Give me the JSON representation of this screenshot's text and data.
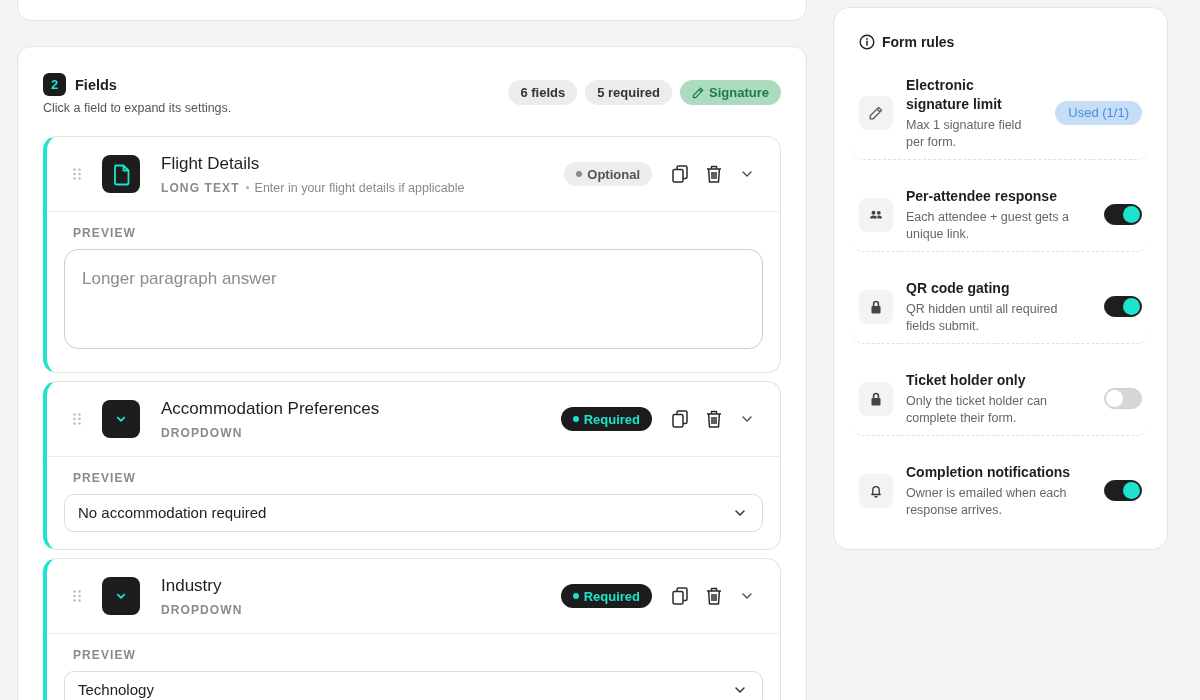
{
  "step": {
    "number": "2",
    "title": "Fields",
    "subtitle": "Click a field to expand its settings."
  },
  "chips": [
    {
      "label": "6 fields",
      "kind": "count"
    },
    {
      "label": "5 required",
      "kind": "count"
    },
    {
      "label": "Signature",
      "kind": "signature"
    }
  ],
  "fields": [
    {
      "kind": "long_text",
      "title": "Flight Details",
      "type_label": "LONG TEXT",
      "description": "Enter in your flight details if applicable",
      "required": false,
      "badge": "Optional",
      "expanded": true,
      "preview_label": "PREVIEW",
      "placeholder": "Longer paragraph answer"
    },
    {
      "kind": "dropdown",
      "title": "Accommodation Preferences",
      "type_label": "DROPDOWN",
      "required": true,
      "badge": "Required",
      "expanded": true,
      "preview_label": "PREVIEW",
      "value": "No accommodation required"
    },
    {
      "kind": "dropdown",
      "title": "Industry",
      "type_label": "DROPDOWN",
      "required": true,
      "badge": "Required",
      "expanded": true,
      "preview_label": "PREVIEW",
      "value": "Technology"
    }
  ],
  "form_rules": {
    "title": "Form rules",
    "rules": [
      {
        "kind": "badge",
        "title": "Electronic signature limit",
        "description": "Max 1 signature field per form.",
        "badge": "Used (1/1)"
      },
      {
        "kind": "toggle",
        "title": "Per-attendee response",
        "description": "Each attendee + guest gets a unique link.",
        "on": true
      },
      {
        "kind": "toggle",
        "title": "QR code gating",
        "description": "QR hidden until all required fields submit.",
        "on": true
      },
      {
        "kind": "toggle",
        "title": "Ticket holder only",
        "description": "Only the ticket holder can complete their form.",
        "on": false
      },
      {
        "kind": "toggle",
        "title": "Completion notifications",
        "description": "Owner is emailed when each response arrives.",
        "on": true
      }
    ]
  }
}
